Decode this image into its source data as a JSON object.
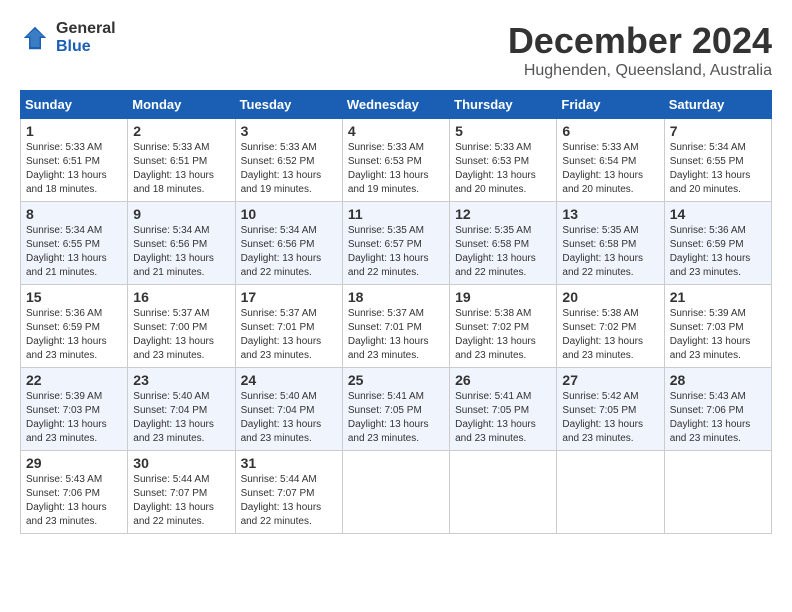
{
  "app": {
    "logo_general": "General",
    "logo_blue": "Blue"
  },
  "header": {
    "month_title": "December 2024",
    "location": "Hughenden, Queensland, Australia"
  },
  "calendar": {
    "days_of_week": [
      "Sunday",
      "Monday",
      "Tuesday",
      "Wednesday",
      "Thursday",
      "Friday",
      "Saturday"
    ],
    "weeks": [
      [
        {
          "day": null,
          "info": ""
        },
        {
          "day": null,
          "info": ""
        },
        {
          "day": null,
          "info": ""
        },
        {
          "day": null,
          "info": ""
        },
        {
          "day": null,
          "info": ""
        },
        {
          "day": null,
          "info": ""
        },
        {
          "day": null,
          "info": ""
        }
      ]
    ],
    "cells": [
      {
        "date": "1",
        "sunrise": "5:33 AM",
        "sunset": "6:51 PM",
        "daylight": "13 hours and 18 minutes."
      },
      {
        "date": "2",
        "sunrise": "5:33 AM",
        "sunset": "6:51 PM",
        "daylight": "13 hours and 18 minutes."
      },
      {
        "date": "3",
        "sunrise": "5:33 AM",
        "sunset": "6:52 PM",
        "daylight": "13 hours and 19 minutes."
      },
      {
        "date": "4",
        "sunrise": "5:33 AM",
        "sunset": "6:53 PM",
        "daylight": "13 hours and 19 minutes."
      },
      {
        "date": "5",
        "sunrise": "5:33 AM",
        "sunset": "6:53 PM",
        "daylight": "13 hours and 20 minutes."
      },
      {
        "date": "6",
        "sunrise": "5:33 AM",
        "sunset": "6:54 PM",
        "daylight": "13 hours and 20 minutes."
      },
      {
        "date": "7",
        "sunrise": "5:34 AM",
        "sunset": "6:55 PM",
        "daylight": "13 hours and 20 minutes."
      },
      {
        "date": "8",
        "sunrise": "5:34 AM",
        "sunset": "6:55 PM",
        "daylight": "13 hours and 21 minutes."
      },
      {
        "date": "9",
        "sunrise": "5:34 AM",
        "sunset": "6:56 PM",
        "daylight": "13 hours and 21 minutes."
      },
      {
        "date": "10",
        "sunrise": "5:34 AM",
        "sunset": "6:56 PM",
        "daylight": "13 hours and 22 minutes."
      },
      {
        "date": "11",
        "sunrise": "5:35 AM",
        "sunset": "6:57 PM",
        "daylight": "13 hours and 22 minutes."
      },
      {
        "date": "12",
        "sunrise": "5:35 AM",
        "sunset": "6:58 PM",
        "daylight": "13 hours and 22 minutes."
      },
      {
        "date": "13",
        "sunrise": "5:35 AM",
        "sunset": "6:58 PM",
        "daylight": "13 hours and 22 minutes."
      },
      {
        "date": "14",
        "sunrise": "5:36 AM",
        "sunset": "6:59 PM",
        "daylight": "13 hours and 23 minutes."
      },
      {
        "date": "15",
        "sunrise": "5:36 AM",
        "sunset": "6:59 PM",
        "daylight": "13 hours and 23 minutes."
      },
      {
        "date": "16",
        "sunrise": "5:37 AM",
        "sunset": "7:00 PM",
        "daylight": "13 hours and 23 minutes."
      },
      {
        "date": "17",
        "sunrise": "5:37 AM",
        "sunset": "7:01 PM",
        "daylight": "13 hours and 23 minutes."
      },
      {
        "date": "18",
        "sunrise": "5:37 AM",
        "sunset": "7:01 PM",
        "daylight": "13 hours and 23 minutes."
      },
      {
        "date": "19",
        "sunrise": "5:38 AM",
        "sunset": "7:02 PM",
        "daylight": "13 hours and 23 minutes."
      },
      {
        "date": "20",
        "sunrise": "5:38 AM",
        "sunset": "7:02 PM",
        "daylight": "13 hours and 23 minutes."
      },
      {
        "date": "21",
        "sunrise": "5:39 AM",
        "sunset": "7:03 PM",
        "daylight": "13 hours and 23 minutes."
      },
      {
        "date": "22",
        "sunrise": "5:39 AM",
        "sunset": "7:03 PM",
        "daylight": "13 hours and 23 minutes."
      },
      {
        "date": "23",
        "sunrise": "5:40 AM",
        "sunset": "7:04 PM",
        "daylight": "13 hours and 23 minutes."
      },
      {
        "date": "24",
        "sunrise": "5:40 AM",
        "sunset": "7:04 PM",
        "daylight": "13 hours and 23 minutes."
      },
      {
        "date": "25",
        "sunrise": "5:41 AM",
        "sunset": "7:05 PM",
        "daylight": "13 hours and 23 minutes."
      },
      {
        "date": "26",
        "sunrise": "5:41 AM",
        "sunset": "7:05 PM",
        "daylight": "13 hours and 23 minutes."
      },
      {
        "date": "27",
        "sunrise": "5:42 AM",
        "sunset": "7:05 PM",
        "daylight": "13 hours and 23 minutes."
      },
      {
        "date": "28",
        "sunrise": "5:43 AM",
        "sunset": "7:06 PM",
        "daylight": "13 hours and 23 minutes."
      },
      {
        "date": "29",
        "sunrise": "5:43 AM",
        "sunset": "7:06 PM",
        "daylight": "13 hours and 23 minutes."
      },
      {
        "date": "30",
        "sunrise": "5:44 AM",
        "sunset": "7:07 PM",
        "daylight": "13 hours and 22 minutes."
      },
      {
        "date": "31",
        "sunrise": "5:44 AM",
        "sunset": "7:07 PM",
        "daylight": "13 hours and 22 minutes."
      }
    ]
  }
}
